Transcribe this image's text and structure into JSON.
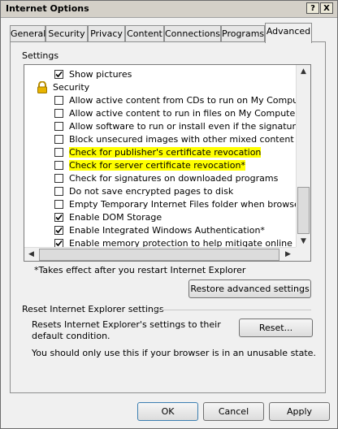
{
  "window": {
    "title": "Internet Options",
    "help_btn": "?",
    "close_btn": "X"
  },
  "tabs": [
    "General",
    "Security",
    "Privacy",
    "Content",
    "Connections",
    "Programs",
    "Advanced"
  ],
  "settings_label": "Settings",
  "settings": [
    {
      "text": "Show pictures",
      "checked": true,
      "highlight": false
    },
    {
      "text": "Security",
      "type": "category"
    },
    {
      "text": "Allow active content from CDs to run on My Computer*",
      "checked": false,
      "highlight": false
    },
    {
      "text": "Allow active content to run in files on My Computer*",
      "checked": false,
      "highlight": false
    },
    {
      "text": "Allow software to run or install even if the signature is inva",
      "checked": false,
      "highlight": false
    },
    {
      "text": "Block unsecured images with other mixed content",
      "checked": false,
      "highlight": false
    },
    {
      "text": "Check for publisher's certificate revocation",
      "checked": false,
      "highlight": true
    },
    {
      "text": "Check for server certificate revocation*",
      "checked": false,
      "highlight": true
    },
    {
      "text": "Check for signatures on downloaded programs",
      "checked": false,
      "highlight": false
    },
    {
      "text": "Do not save encrypted pages to disk",
      "checked": false,
      "highlight": false
    },
    {
      "text": "Empty Temporary Internet Files folder when browser is clo",
      "checked": false,
      "highlight": false
    },
    {
      "text": "Enable DOM Storage",
      "checked": true,
      "highlight": false
    },
    {
      "text": "Enable Integrated Windows Authentication*",
      "checked": true,
      "highlight": false
    },
    {
      "text": "Enable memory protection to help mitigate online attacks*",
      "checked": true,
      "highlight": false
    }
  ],
  "note": "*Takes effect after you restart Internet Explorer",
  "restore_btn": "Restore advanced settings",
  "reset_section": {
    "title": "Reset Internet Explorer settings",
    "desc": "Resets Internet Explorer's settings to their default condition.",
    "reset_btn": "Reset...",
    "warning": "You should only use this if your browser is in an unusable state."
  },
  "footer": {
    "ok": "OK",
    "cancel": "Cancel",
    "apply": "Apply"
  },
  "colors": {
    "highlight": "#ffff00",
    "check": "#000000"
  }
}
